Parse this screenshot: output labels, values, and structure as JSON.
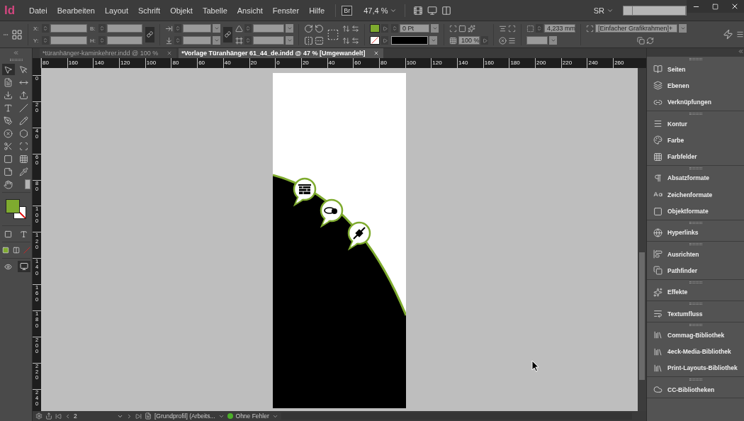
{
  "app": {
    "logo": "Id",
    "menu": [
      "Datei",
      "Bearbeiten",
      "Layout",
      "Schrift",
      "Objekt",
      "Tabelle",
      "Ansicht",
      "Fenster",
      "Hilfe"
    ],
    "bridge": "Br",
    "zoom": "47,4 %",
    "workspace": "SR"
  },
  "control_bar": {
    "x_label": "X:",
    "y_label": "Y:",
    "w_label": "B:",
    "h_label": "H:",
    "stroke_weight": "0 Pt",
    "opacity": "100 %",
    "frame_size": "4,233 mm",
    "object_style": "[Einfacher Grafikrahmen]+"
  },
  "tabs": [
    {
      "label": "*türanhänger-kaminkehrer.indd @ 100 %",
      "selected": false
    },
    {
      "label": "*Vorlage Türanhänger 61_44_de.indd @ 47 % [Umgewandelt]",
      "selected": true
    }
  ],
  "ruler": {
    "horizontal": [
      "80",
      "160",
      "140",
      "120",
      "100",
      "80",
      "60",
      "40",
      "20",
      "0",
      "20",
      "40",
      "60",
      "80",
      "100",
      "120",
      "140",
      "160",
      "180",
      "200",
      "220",
      "240",
      "260"
    ],
    "vertical": [
      "0",
      "20",
      "40",
      "60",
      "80",
      "100",
      "120",
      "140",
      "160",
      "180",
      "200",
      "220",
      "240"
    ]
  },
  "panels": [
    {
      "items": [
        {
          "label": "Seiten",
          "kind": "pages"
        },
        {
          "label": "Ebenen",
          "kind": "layers"
        },
        {
          "label": "Verknüpfungen",
          "kind": "links"
        }
      ]
    },
    {
      "items": [
        {
          "label": "Kontur",
          "kind": "stroke"
        },
        {
          "label": "Farbe",
          "kind": "color"
        },
        {
          "label": "Farbfelder",
          "kind": "swatches"
        }
      ]
    },
    {
      "items": [
        {
          "label": "Absatzformate",
          "kind": "paragraph"
        },
        {
          "label": "Zeichenformate",
          "kind": "character"
        },
        {
          "label": "Objektformate",
          "kind": "object"
        }
      ]
    },
    {
      "items": [
        {
          "label": "Hyperlinks",
          "kind": "hyperlinks"
        }
      ]
    },
    {
      "items": [
        {
          "label": "Ausrichten",
          "kind": "align"
        },
        {
          "label": "Pathfinder",
          "kind": "pathfinder"
        }
      ]
    },
    {
      "items": [
        {
          "label": "Effekte",
          "kind": "effects"
        }
      ]
    },
    {
      "items": [
        {
          "label": "Textumfluss",
          "kind": "wrap"
        }
      ]
    },
    {
      "items": [
        {
          "label": "Commag-Bibliothek",
          "kind": "library"
        },
        {
          "label": "4eck-Media-Bibliothek",
          "kind": "library"
        },
        {
          "label": "Print-Layouts-Bibliothek",
          "kind": "library"
        }
      ]
    },
    {
      "items": [
        {
          "label": "CC-Bibliotheken",
          "kind": "cloud"
        }
      ]
    }
  ],
  "status_bar": {
    "page": "2",
    "profile": "[Grundprofil] (Arbeits...",
    "preflight": "Ohne Fehler"
  }
}
